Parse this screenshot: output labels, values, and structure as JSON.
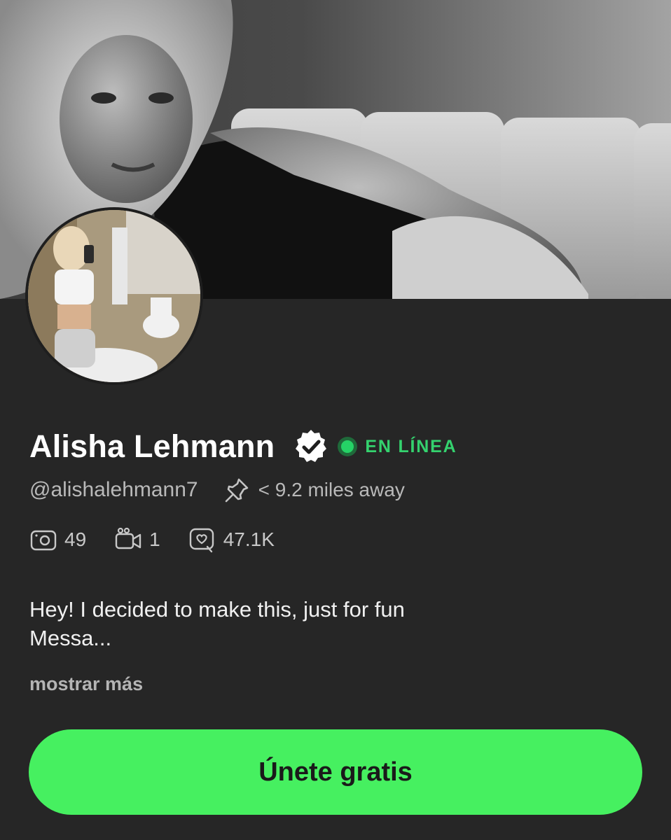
{
  "profile": {
    "name": "Alisha Lehmann",
    "status": "EN LÍNEA",
    "handle": "@alishalehmann7",
    "distance": "< 9.2 miles away",
    "verified": true
  },
  "stats": [
    {
      "icon": "camera-icon",
      "value": "49"
    },
    {
      "icon": "video-icon",
      "value": "1"
    },
    {
      "icon": "likes-icon",
      "value": "47.1K"
    }
  ],
  "bio": {
    "line1": "Hey! I decided to make this, just for fun",
    "line2": "Messa..."
  },
  "show_more_label": "mostrar más",
  "cta_label": "Únete gratis",
  "colors": {
    "background": "#262626",
    "accent_green": "#46f060",
    "online_green": "#34d26e",
    "text_primary": "#ffffff",
    "text_secondary": "#b9b9b9"
  }
}
